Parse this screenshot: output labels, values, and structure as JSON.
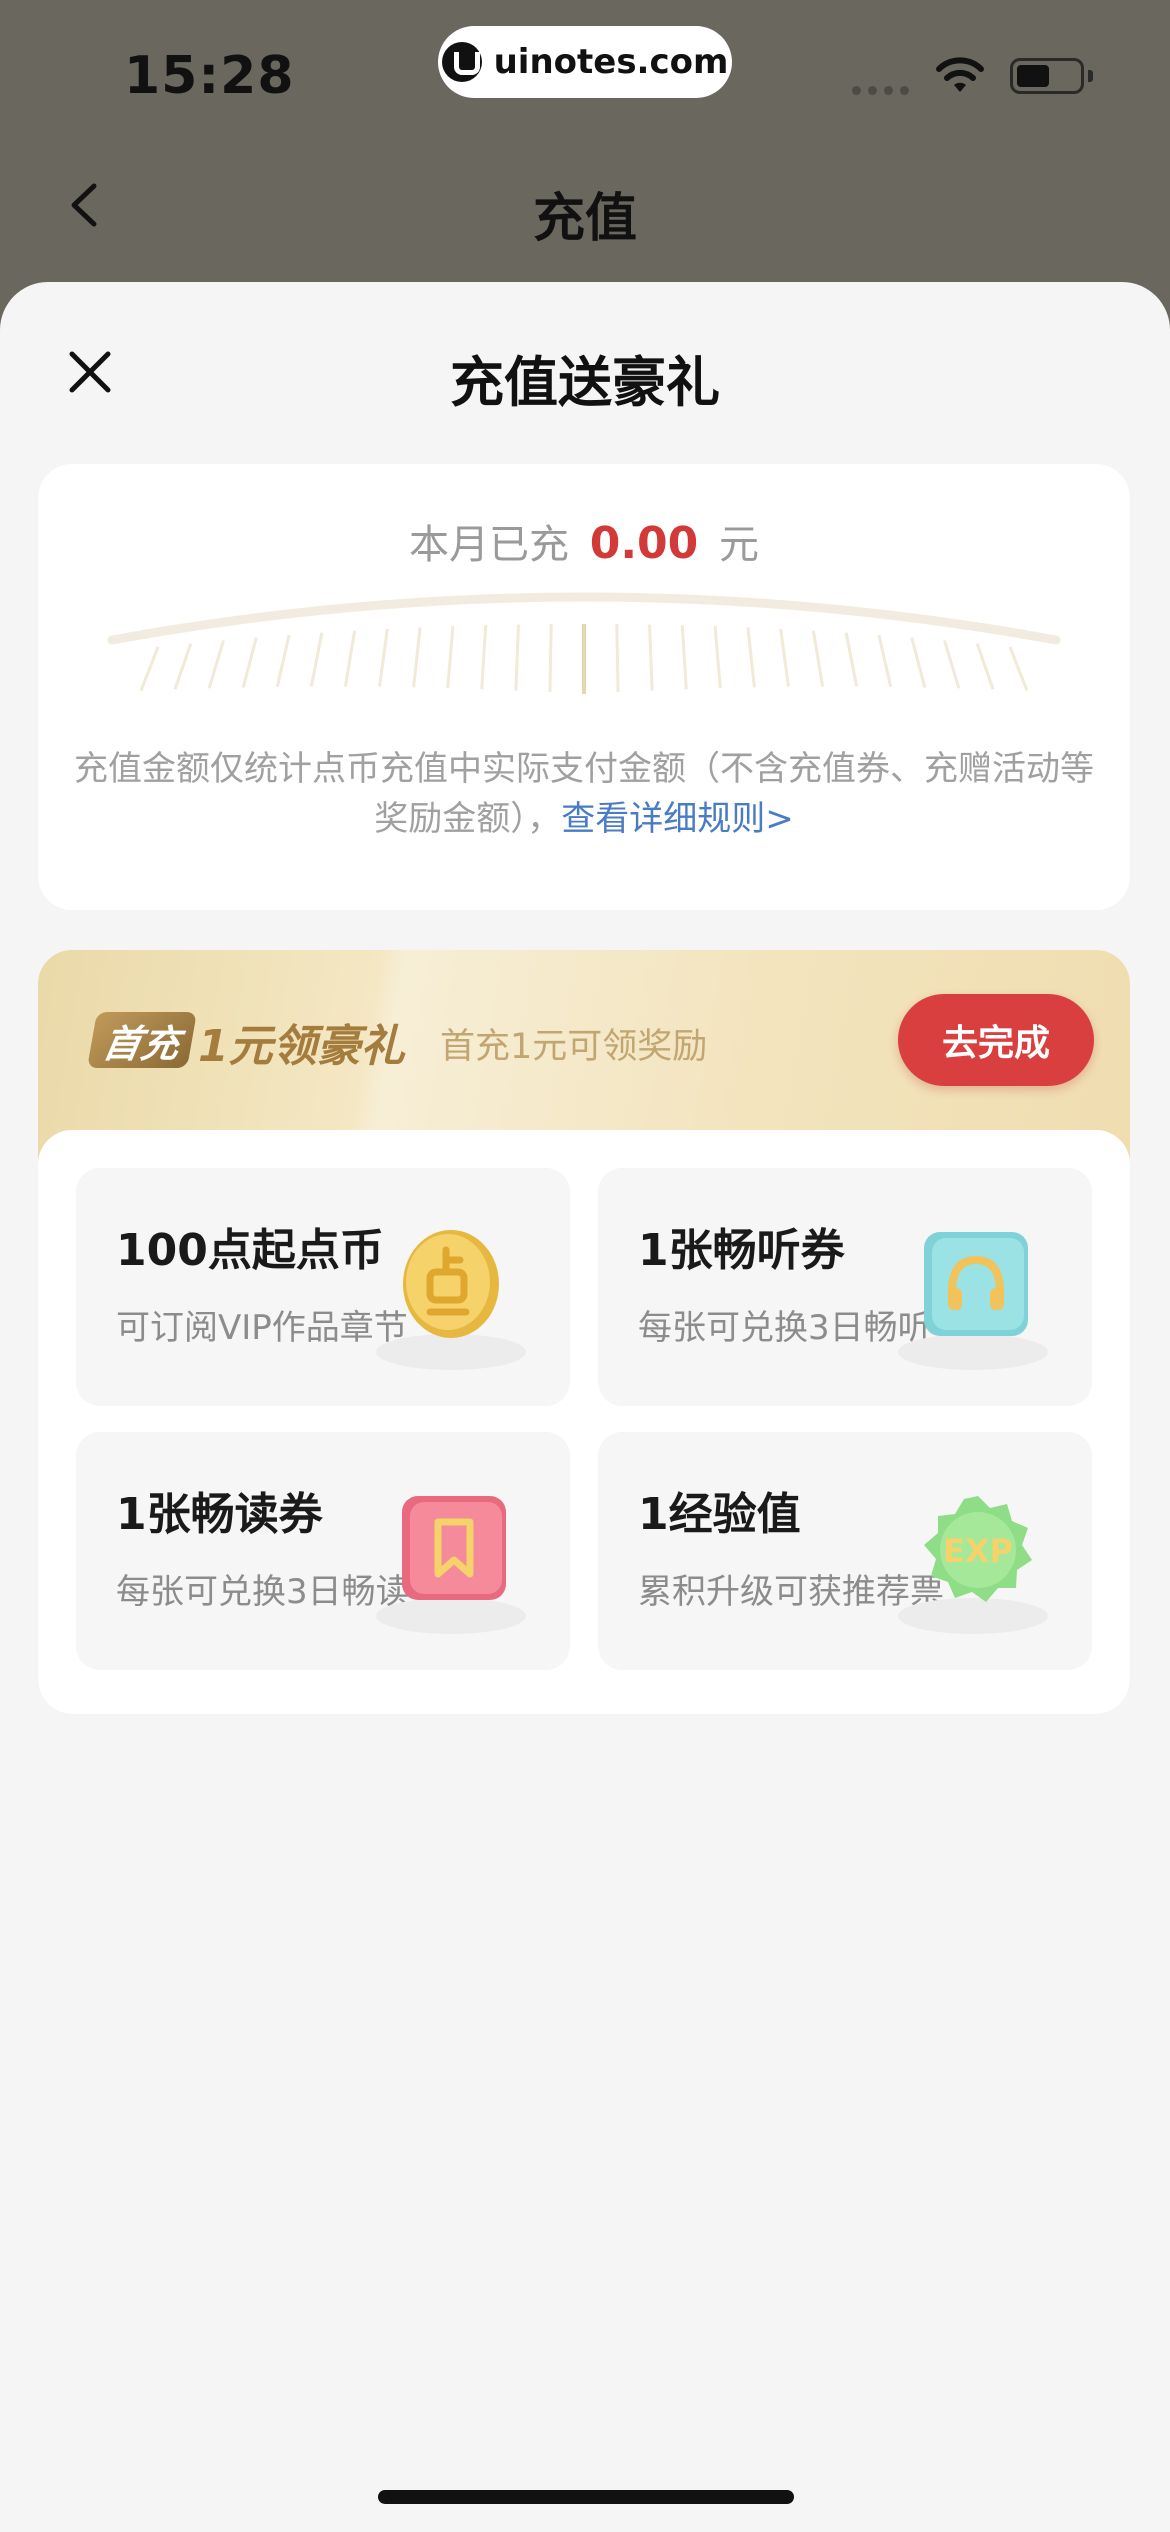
{
  "status_bar": {
    "time": "15:28",
    "url": "uinotes.com",
    "icons": [
      "signal-icon",
      "wifi-icon",
      "battery-icon"
    ]
  },
  "nav": {
    "title": "充值",
    "back_icon": "chevron-left-icon"
  },
  "sheet": {
    "title": "充值送豪礼",
    "close_icon": "close-icon"
  },
  "summary": {
    "prefix": "本月已充",
    "amount": "0.00",
    "unit": "元",
    "note": "充值金额仅统计点币充值中实际支付金额（不含充值券、充赠活动等奖励金额），",
    "rules_link": "查看详细规则>",
    "progress": 0
  },
  "first_recharge": {
    "badge": "首充",
    "headline": "1元领豪礼",
    "subtitle": "首充1元可领奖励",
    "button": "去完成",
    "rewards": [
      {
        "title": "100点起点币",
        "desc": "可订阅VIP作品章节",
        "icon": "coin-icon"
      },
      {
        "title": "1张畅听券",
        "desc": "每张可兑换3日畅听",
        "icon": "headphones-ticket-icon"
      },
      {
        "title": "1张畅读券",
        "desc": "每张可兑换3日畅读",
        "icon": "bookmark-ticket-icon"
      },
      {
        "title": "1经验值",
        "desc": "累积升级可获推荐票",
        "icon": "exp-badge-icon"
      }
    ]
  },
  "colors": {
    "accent_red": "#d93f3f",
    "amount_red": "#d23a3a",
    "link_blue": "#4a7cc4",
    "gold": "#a47c3e"
  }
}
